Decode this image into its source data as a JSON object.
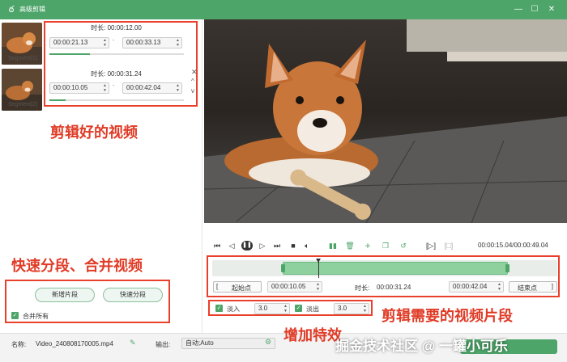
{
  "window": {
    "title": "高级剪辑"
  },
  "segments": [
    {
      "label": "Segment[1]",
      "duration": "时长:  00:00:12.00",
      "start": "00:00:21.13",
      "end": "00:00:33.13",
      "progress": 0.3
    },
    {
      "label": "Segment[2]",
      "duration": "时长:  00:00:31.24",
      "start": "00:00:10.05",
      "end": "00:00:42.04",
      "progress": 0.12
    }
  ],
  "left_actions": {
    "new_segment": "新增片段",
    "quick_split": "快速分段",
    "merge_all": "合并所有",
    "merge_all_checked": true
  },
  "annotations": {
    "edited_videos": "剪辑好的视频",
    "quick_split_merge": "快速分段、合并视频",
    "segment_needed": "剪辑需要的视频片段",
    "add_effects": "增加特效"
  },
  "playback": {
    "time": "00:00:15.04/00:00:49.04"
  },
  "clip": {
    "start_label": "起始点",
    "start": "00:00:10.05",
    "duration_label": "时长:",
    "duration": "00:00:31.24",
    "end": "00:00:42.04",
    "end_label": "结束点",
    "range_start": 0.205,
    "range_end": 0.857,
    "playhead": 0.307
  },
  "effects": {
    "fade_in_label": "淡入",
    "fade_in": "3.0",
    "fade_out_label": "淡出",
    "fade_out": "3.0"
  },
  "output": {
    "name_label": "名称:",
    "name": "Video_240808170005.mp4",
    "output_label": "输出:",
    "output": "自动;Auto"
  },
  "watermark": "掘金技术社区 @ 一罐小可乐",
  "colors": {
    "accent": "#4ea56a",
    "annotation": "#e03b26"
  }
}
